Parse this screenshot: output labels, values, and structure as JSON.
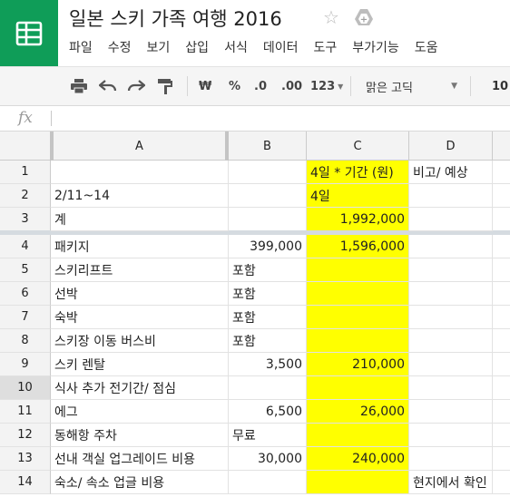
{
  "document": {
    "title": "일본 스키 가족 여행 2016"
  },
  "menu": [
    "파일",
    "수정",
    "보기",
    "삽입",
    "서식",
    "데이터",
    "도구",
    "부가기능",
    "도움"
  ],
  "toolbar": {
    "currency": "₩",
    "percent": "%",
    "decrease_decimal": ".0",
    "increase_decimal": ".00",
    "number_format": "123",
    "font_name": "맑은 고딕",
    "font_size": "10"
  },
  "formula_bar": {
    "fx": "fx",
    "value": ""
  },
  "columns": [
    "A",
    "B",
    "C",
    "D"
  ],
  "rows": [
    {
      "num": "1",
      "a": "",
      "b": "",
      "c": "4일 * 기간 (원)",
      "d": "비고/ 예상"
    },
    {
      "num": "2",
      "a": "2/11~14",
      "b": "",
      "c": "4일",
      "d": ""
    },
    {
      "num": "3",
      "a": "계",
      "b": "",
      "c": "1,992,000",
      "d": ""
    },
    {
      "num": "4",
      "a": "패키지",
      "b": "399,000",
      "c": "1,596,000",
      "d": ""
    },
    {
      "num": "5",
      "a": "스키리프트",
      "b": "포함",
      "c": "",
      "d": ""
    },
    {
      "num": "6",
      "a": "선박",
      "b": "포함",
      "c": "",
      "d": ""
    },
    {
      "num": "7",
      "a": "숙박",
      "b": "포함",
      "c": "",
      "d": ""
    },
    {
      "num": "8",
      "a": "스키장 이동 버스비",
      "b": "포함",
      "c": "",
      "d": ""
    },
    {
      "num": "9",
      "a": "스키 렌탈",
      "b": "3,500",
      "c": "210,000",
      "d": ""
    },
    {
      "num": "10",
      "a": "식사 추가 전기간/ 점심",
      "b": "",
      "c": "",
      "d": ""
    },
    {
      "num": "11",
      "a": "에그",
      "b": "6,500",
      "c": "26,000",
      "d": ""
    },
    {
      "num": "12",
      "a": "동해항 주차",
      "b": "무료",
      "c": "",
      "d": ""
    },
    {
      "num": "13",
      "a": "선내 객실 업그레이드 비용",
      "b": "30,000",
      "c": "240,000",
      "d": ""
    },
    {
      "num": "14",
      "a": "숙소/ 속소 업글 비용",
      "b": "",
      "c": "",
      "d": "현지에서 확인"
    }
  ],
  "colors": {
    "brand": "#0f9d58",
    "highlight": "#ffff00"
  }
}
